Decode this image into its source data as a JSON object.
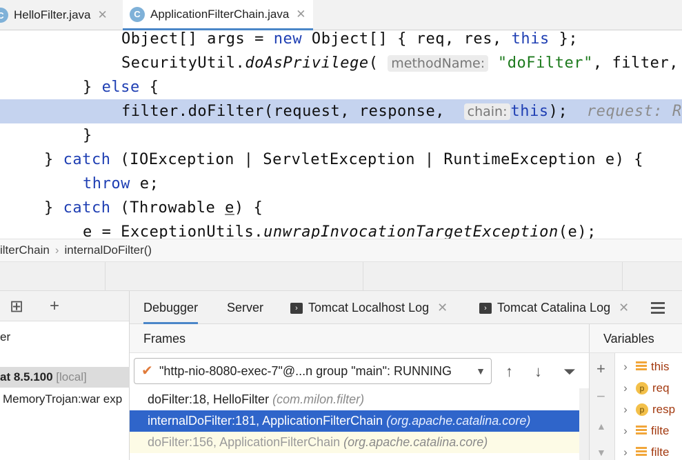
{
  "editor": {
    "tabs": [
      {
        "label": "HelloFilter.java",
        "icon": "class-icon",
        "active": false
      },
      {
        "label": "ApplicationFilterChain.java",
        "icon": "class-icon",
        "active": true
      }
    ],
    "code": {
      "l0_a": "Object[] args = ",
      "l0_new": "new",
      "l0_b": " Object[] { req, res, ",
      "l0_this": "this",
      "l0_c": " };",
      "l1_a": "SecurityUtil.",
      "l1_method": "doAsPrivilege",
      "l1_b": "( ",
      "l1_hint": "methodName:",
      "l1_str": " \"doFilter\"",
      "l1_c": ", filter,",
      "l2_a": "} ",
      "l2_else": "else",
      "l2_b": " {",
      "l3_a": "filter.doFilter(request, response,  ",
      "l3_hint": "chain:",
      "l3_this": "this",
      "l3_b": ");  ",
      "l3_inline": "request: R",
      "l4": "}",
      "l5_a": "} ",
      "l5_catch": "catch",
      "l5_b": " (IOException | ServletException | RuntimeException e) {",
      "l6_throw": "throw",
      "l6_b": " e;",
      "l7_a": "} ",
      "l7_catch": "catch",
      "l7_b": " (Throwable ",
      "l7_e": "e",
      "l7_c": ") {",
      "l8_a": "e = ExceptionUtils.",
      "l8_method": "unwrapInvocationTargetException",
      "l8_b": "(e);"
    }
  },
  "breadcrumb": {
    "class": "ilterChain",
    "method": "internalDoFilter()"
  },
  "services": {
    "item_partial": "er",
    "server_name": "at 8.5.100",
    "server_tag": "[local]",
    "artifact": "MemoryTrojan:war exp"
  },
  "debug_tabs": [
    {
      "label": "Debugger",
      "active": true,
      "closable": false
    },
    {
      "label": "Server",
      "active": false,
      "closable": false
    },
    {
      "label": "Tomcat Localhost Log",
      "active": false,
      "closable": true
    },
    {
      "label": "Tomcat Catalina Log",
      "active": false,
      "closable": true
    }
  ],
  "frames": {
    "header": "Frames",
    "thread": "\"http-nio-8080-exec-7\"@...n group \"main\": RUNNING",
    "rows": [
      {
        "method": "doFilter:18, HelloFilter",
        "pkg": "(com.milon.filter)",
        "state": "normal"
      },
      {
        "method": "internalDoFilter:181, ApplicationFilterChain",
        "pkg": "(org.apache.catalina.core)",
        "state": "selected"
      },
      {
        "method": "doFilter:156, ApplicationFilterChain",
        "pkg": "(org.apache.catalina.core)",
        "state": "library"
      }
    ]
  },
  "variables": {
    "header": "Variables",
    "rows": [
      {
        "name": "this",
        "kind": "field"
      },
      {
        "name": "req",
        "kind": "param"
      },
      {
        "name": "resp",
        "kind": "param"
      },
      {
        "name": "filte",
        "kind": "field"
      },
      {
        "name": "filte",
        "kind": "field"
      }
    ]
  },
  "colors": {
    "accent": "#2f65ca",
    "keyword": "#1f3fb3",
    "string": "#1d7a1d",
    "highlight_line": "#c5d3ef"
  }
}
